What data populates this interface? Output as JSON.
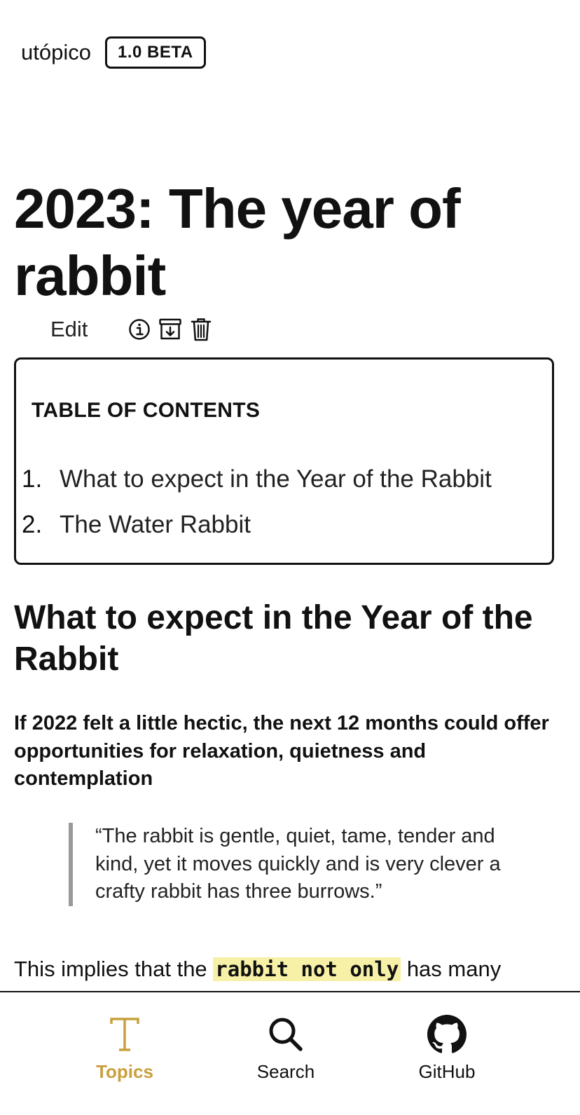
{
  "header": {
    "brand": "utópico",
    "badge": "1.0 BETA"
  },
  "article": {
    "title": "2023: The year of rabbit",
    "edit_label": "Edit",
    "toc": {
      "heading": "TABLE OF CONTENTS",
      "items": [
        {
          "num": "1.",
          "label": "What to expect in the Year of the Rabbit"
        },
        {
          "num": "2.",
          "label": "The Water Rabbit"
        }
      ]
    },
    "section_heading": "What to expect in the Year of the Rabbit",
    "lead": "If 2022 felt a little hectic, the next 12 months could offer opportunities for relaxation, quietness and contemplation",
    "quote": "“The rabbit is gentle, quiet, tame, tender and kind, yet it moves quickly and is very clever a crafty rabbit has three burrows.”",
    "body_before": "This implies that the ",
    "body_code": "rabbit not only",
    "body_after": " has many"
  },
  "tabs": [
    {
      "label": "Topics",
      "icon": "topics-t-icon",
      "active": true
    },
    {
      "label": "Search",
      "icon": "search-icon",
      "active": false
    },
    {
      "label": "GitHub",
      "icon": "github-icon",
      "active": false
    }
  ],
  "colors": {
    "accent": "#c9a03d",
    "highlight": "#f7f1a8",
    "quote_border": "#999999"
  }
}
